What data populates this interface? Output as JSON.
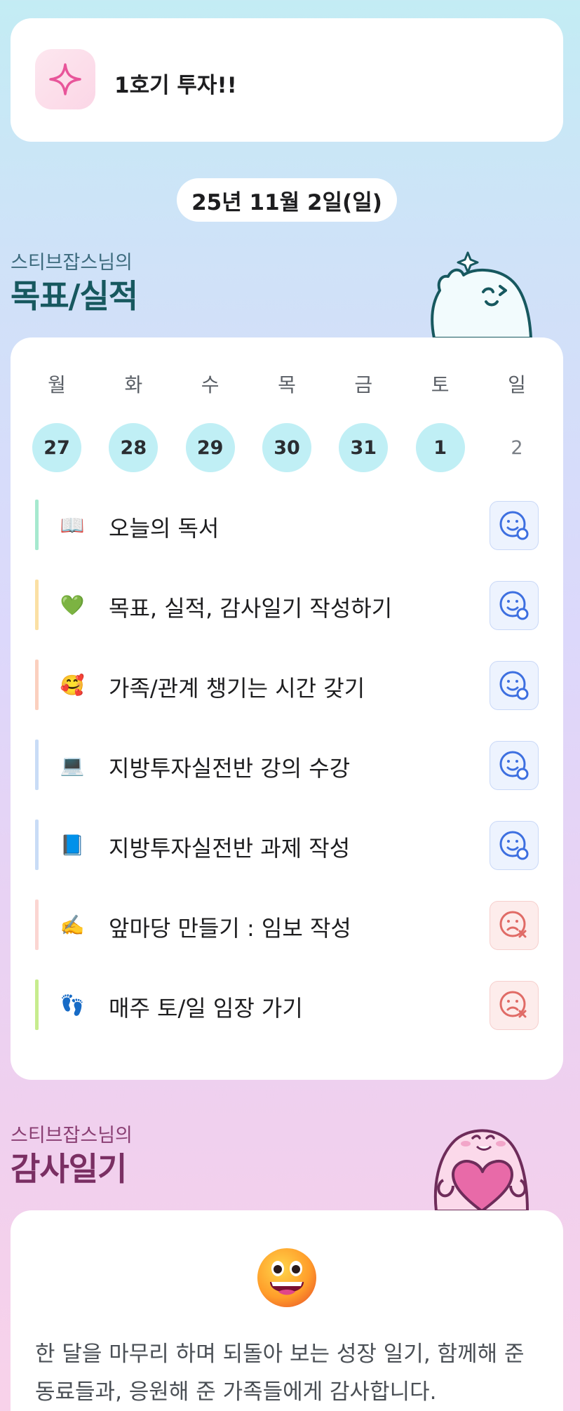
{
  "header": {
    "title": "1호기 투자!!",
    "icon": "sparkle-icon"
  },
  "date": "25년 11월 2일(일)",
  "goals_section": {
    "subtitle": "스티브잡스님의",
    "title": "목표/실적"
  },
  "week": {
    "days": [
      {
        "label": "월",
        "num": "27",
        "done": true
      },
      {
        "label": "화",
        "num": "28",
        "done": true
      },
      {
        "label": "수",
        "num": "29",
        "done": true
      },
      {
        "label": "목",
        "num": "30",
        "done": true
      },
      {
        "label": "금",
        "num": "31",
        "done": true
      },
      {
        "label": "토",
        "num": "1",
        "done": true
      },
      {
        "label": "일",
        "num": "2",
        "done": false
      }
    ]
  },
  "goals": [
    {
      "emoji": "📖",
      "text": "오늘의 독서",
      "bar_color": "#a6e9cf",
      "status": "ok"
    },
    {
      "emoji": "💚",
      "text": "목표, 실적, 감사일기 작성하기",
      "bar_color": "#fbe0a4",
      "status": "ok"
    },
    {
      "emoji": "🥰",
      "text": "가족/관계 챙기는 시간 갖기",
      "bar_color": "#fbd0bf",
      "status": "ok"
    },
    {
      "emoji": "💻",
      "text": "지방투자실전반 강의 수강",
      "bar_color": "#c9dcf6",
      "status": "ok"
    },
    {
      "emoji": "📘",
      "text": "지방투자실전반 과제 작성",
      "bar_color": "#c9dcf6",
      "status": "ok"
    },
    {
      "emoji": "✍️",
      "text": "앞마당 만들기 : 임보 작성",
      "bar_color": "#fbd6d2",
      "status": "bad"
    },
    {
      "emoji": "👣",
      "text": "매주 토/일 임장 가기",
      "bar_color": "#c7ec8e",
      "status": "bad"
    }
  ],
  "gratitude_section": {
    "subtitle": "스티브잡스님의",
    "title": "감사일기"
  },
  "gratitude": {
    "emoji": "grinning-face-icon",
    "text": "한 달을 마무리 하며 되돌아 보는 성장 일기, 함께해 준 동료들과, 응원해 준 가족들에게 감사합니다."
  },
  "colors": {
    "teal_title": "#17585f",
    "plum_title": "#7a2f63",
    "ok_icon": "#3d6fe0",
    "bad_icon": "#e06b66"
  }
}
